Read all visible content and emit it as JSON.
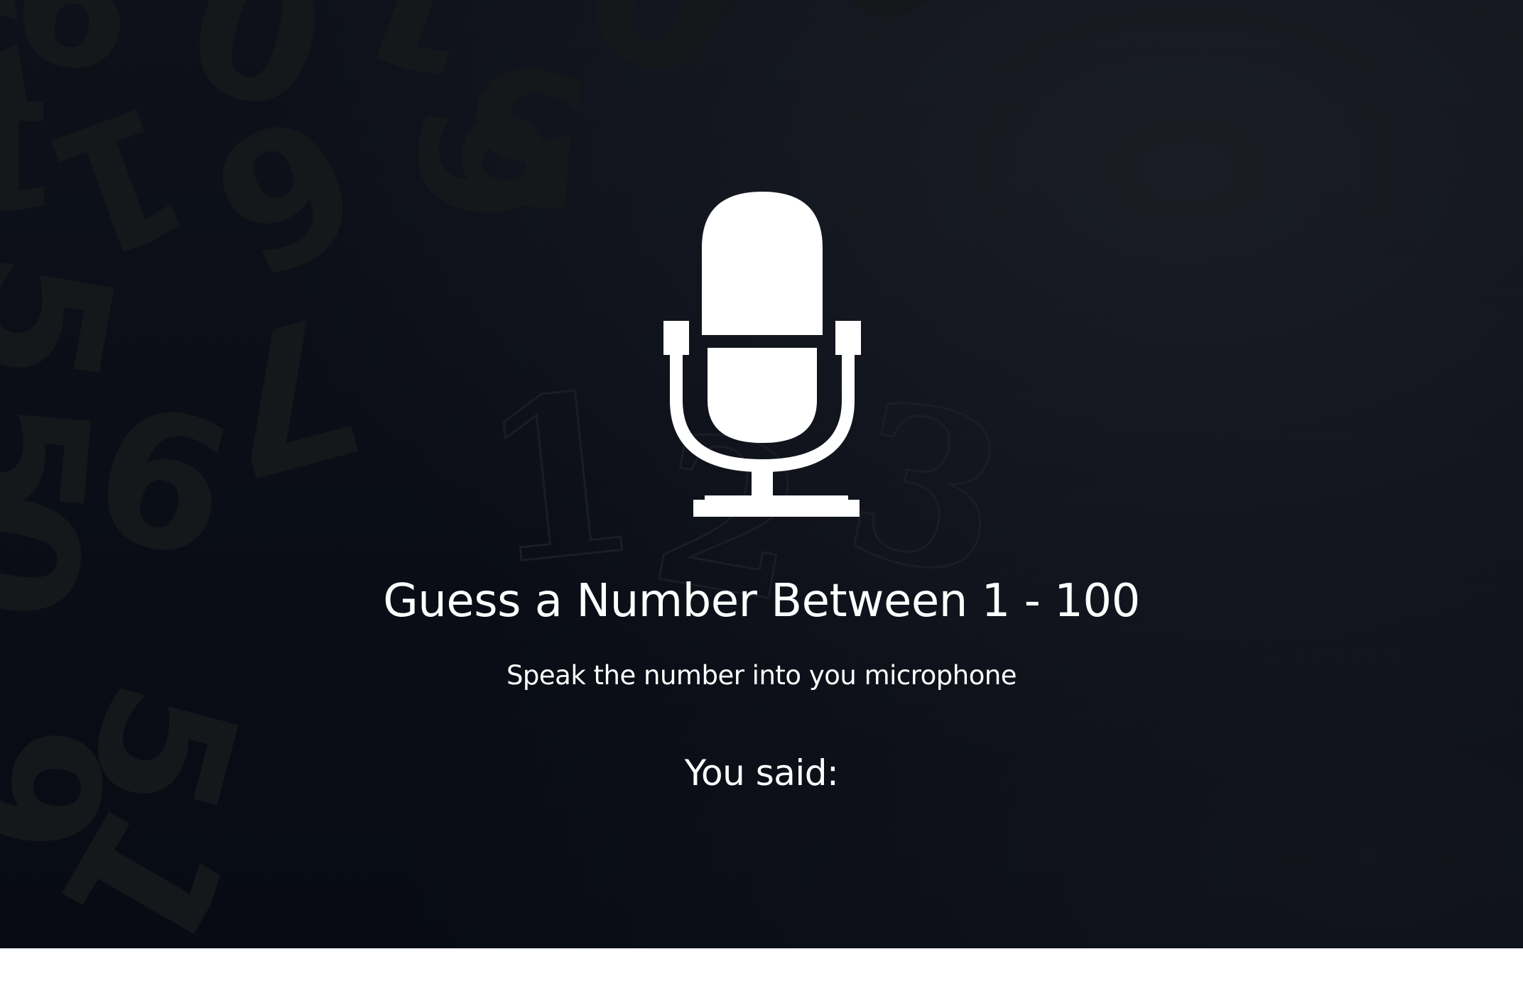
{
  "page": {
    "title": "Guess a Number Between 1 - 100",
    "subtitle": "Speak the number into you microphone",
    "result_label": "You said:",
    "result_value": ""
  },
  "background": {
    "digits": [
      "9",
      "0",
      "1",
      "5",
      "0",
      "9",
      "6",
      "9",
      "1",
      "5",
      "5",
      "7",
      "9",
      "0",
      "9",
      "5",
      "1",
      "5",
      "1"
    ],
    "outline_digits": [
      "1",
      "2",
      "3"
    ]
  },
  "icons": {
    "microphone": "microphone-icon"
  },
  "colors": {
    "background": "#0b0e17",
    "text": "#ffffff",
    "icon": "#ffffff",
    "footer": "#ffffff"
  }
}
